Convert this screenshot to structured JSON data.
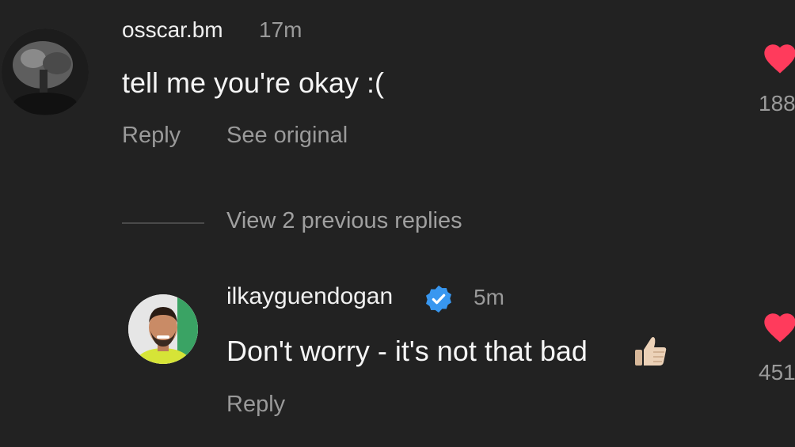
{
  "colors": {
    "background": "#222222",
    "primary_text": "#f2f2f2",
    "secondary_text": "#9a9a9a",
    "like_heart": "#ff3b5c",
    "verified_badge": "#3897f0"
  },
  "comments": [
    {
      "username": "osscar.bm",
      "time": "17m",
      "text": "tell me you're okay :(",
      "actions": {
        "reply": "Reply",
        "see_original": "See original"
      },
      "likes": "188",
      "avatar_icon": "avatar-photo-icon",
      "like_icon": "heart-icon"
    }
  ],
  "view_replies": "View 2 previous replies",
  "reply": {
    "username": "ilkayguendogan",
    "verified": true,
    "verified_icon": "verified-badge-icon",
    "time": "5m",
    "text": "Don't worry - it's not that bad",
    "emoji_icon": "thumbs-up-icon",
    "actions": {
      "reply": "Reply"
    },
    "likes": "451",
    "like_icon": "heart-icon"
  }
}
